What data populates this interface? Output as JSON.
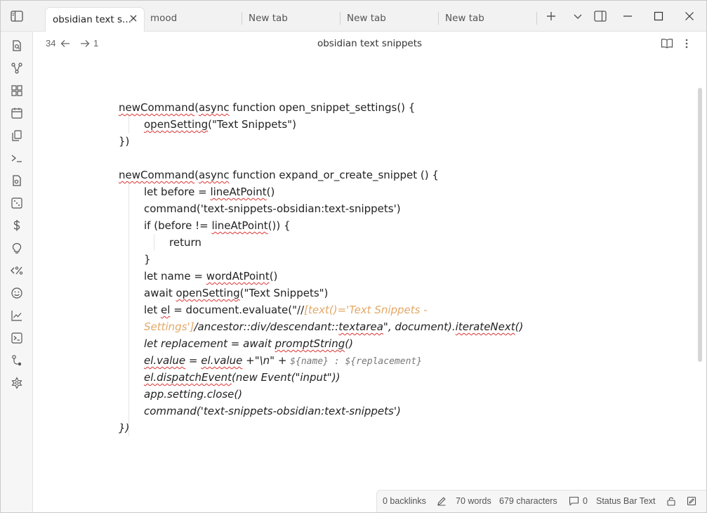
{
  "tabs": [
    {
      "label": "obsidian text s..."
    },
    {
      "label": "mood"
    },
    {
      "label": "New tab"
    },
    {
      "label": "New tab"
    },
    {
      "label": "New tab"
    }
  ],
  "header": {
    "title": "obsidian text snippets",
    "back_count": "34",
    "forward_count": "1"
  },
  "status": {
    "backlinks": "0 backlinks",
    "words": "70 words",
    "characters": "679 characters",
    "comments_count": "0",
    "status_text": "Status Bar Text"
  },
  "code": {
    "l1a": "newCommand",
    "l1b": "(",
    "l1c": "async",
    "l1d": " function open_snippet_settings() {",
    "l2a": "openSetting",
    "l2b": "(\"Text Snippets\")",
    "l3": "})",
    "l5a": "newCommand",
    "l5b": "(",
    "l5c": "async",
    "l5d": " function expand_or_create_snippet () {",
    "l6a": "let before = ",
    "l6b": "lineAtPoint",
    "l6c": "()",
    "l7": "command('text-snippets-obsidian:text-snippets')",
    "l8a": "if (before != ",
    "l8b": "lineAtPoint",
    "l8c": "()) {",
    "l9": "return",
    "l10": "}",
    "l11a": "let name = ",
    "l11b": "wordAtPoint",
    "l11c": "()",
    "l12a": "await ",
    "l12b": "openSetting",
    "l12c": "(\"Text Snippets\")",
    "l13a": "let ",
    "l13b": "el",
    "l13c": " = document.evaluate(\"//",
    "l13d": "[text()='Text Snippets -",
    "l14a": "Settings']",
    "l14b": "/ancestor::div/descendant::",
    "l14c": "textarea",
    "l14d": "\", document).",
    "l14e": "iterateNext",
    "l14f": "()",
    "l15a": "let replacement = await ",
    "l15b": "promptString",
    "l15c": "()",
    "l16a": "el.value",
    "l16b": " = ",
    "l16c": "el.value",
    "l16d": " +\"\\n\" + ",
    "l16e": "${name} : ${replacement}",
    "l17a": "el.dispatchEvent",
    "l17b": "(new Event(\"input\"))",
    "l18": "app.setting.close()",
    "l19": "command('text-snippets-obsidian:text-snippets')",
    "l20": "})"
  }
}
